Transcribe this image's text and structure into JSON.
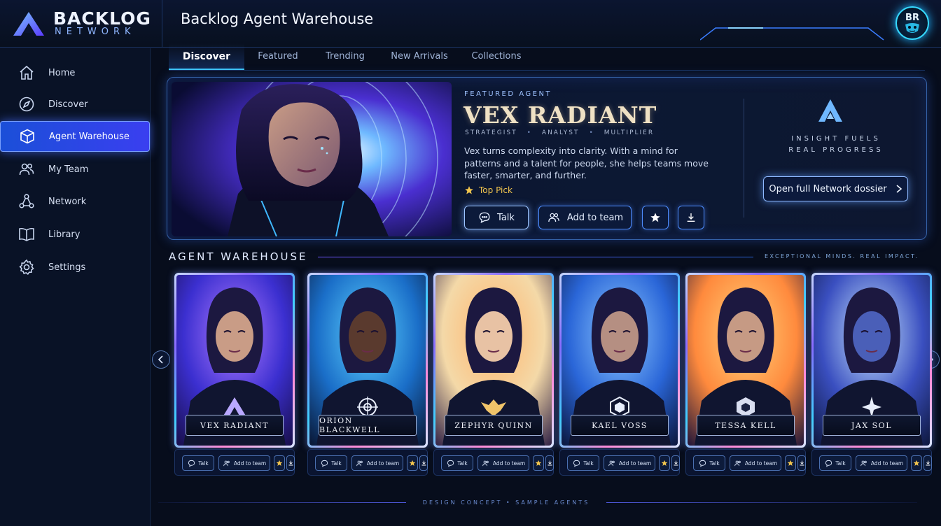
{
  "brand": {
    "line1": "BACKLOG",
    "line2": "NETWORK"
  },
  "header": {
    "title": "Backlog Agent Warehouse",
    "user_initials": "BR"
  },
  "sidebar": {
    "items": [
      {
        "label": "Home",
        "icon": "home-icon"
      },
      {
        "label": "Discover",
        "icon": "compass-icon"
      },
      {
        "label": "Agent Warehouse",
        "icon": "cube-icon",
        "active": true
      },
      {
        "label": "My Team",
        "icon": "users-icon"
      },
      {
        "label": "Network",
        "icon": "network-icon"
      },
      {
        "label": "Library",
        "icon": "book-icon"
      },
      {
        "label": "Settings",
        "icon": "gear-icon"
      }
    ]
  },
  "tabs": [
    "Discover",
    "Featured",
    "Trending",
    "New Arrivals",
    "Collections"
  ],
  "active_tab": "Discover",
  "featured": {
    "kicker": "FEATURED AGENT",
    "name": "VEX RADIANT",
    "roles": [
      "STRATEGIST",
      "ANALYST",
      "MULTIPLIER"
    ],
    "role_separator": "•",
    "description": "Vex turns complexity into clarity. With a mind for patterns and a talent for people, she helps teams move faster, smarter, and further.",
    "badge": "Top Pick",
    "talk_label": "Talk",
    "add_label": "Add to team",
    "tagline_1": "INSIGHT FUELS",
    "tagline_2": "REAL PROGRESS",
    "dossier_label": "Open full Network dossier"
  },
  "warehouse": {
    "title": "AGENT WAREHOUSE",
    "motto": "EXCEPTIONAL MINDS. REAL IMPACT.",
    "talk_label": "Talk",
    "add_label": "Add to team",
    "agents": [
      {
        "name": "VEX RADIANT",
        "emblem": "triangle-emblem-icon"
      },
      {
        "name": "ORION BLACKWELL",
        "emblem": "target-emblem-icon"
      },
      {
        "name": "ZEPHYR QUINN",
        "emblem": "wings-emblem-icon"
      },
      {
        "name": "KAEL VOSS",
        "emblem": "hexagon-emblem-icon"
      },
      {
        "name": "TESSA KELL",
        "emblem": "hex-nut-emblem-icon"
      },
      {
        "name": "JAX SOL",
        "emblem": "star-emblem-icon"
      }
    ]
  },
  "footer": {
    "text": "DESIGN CONCEPT  •  SAMPLE AGENTS"
  },
  "colors": {
    "accent": "#3fc6ff",
    "active_nav": "#2a4fe0",
    "gold": "#f3c64e",
    "background": "#070d1c"
  }
}
